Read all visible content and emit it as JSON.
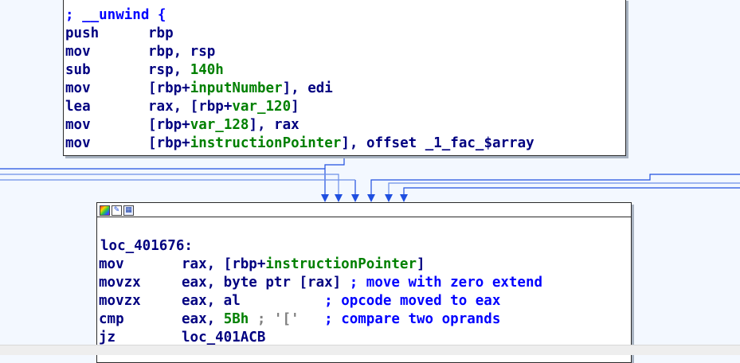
{
  "top_block": {
    "lines": [
      {
        "comment": "; __unwind {"
      },
      {
        "mnemonic": "push",
        "parts": [
          {
            "t": "rbp",
            "c": "reg"
          }
        ]
      },
      {
        "mnemonic": "mov",
        "parts": [
          {
            "t": "rbp, rsp",
            "c": "reg"
          }
        ]
      },
      {
        "mnemonic": "sub",
        "parts": [
          {
            "t": "rsp, ",
            "c": "reg"
          },
          {
            "t": "140h",
            "c": "num"
          }
        ]
      },
      {
        "mnemonic": "mov",
        "parts": [
          {
            "t": "[rbp+",
            "c": "reg"
          },
          {
            "t": "inputNumber",
            "c": "var"
          },
          {
            "t": "], edi",
            "c": "reg"
          }
        ]
      },
      {
        "mnemonic": "lea",
        "parts": [
          {
            "t": "rax, [rbp+",
            "c": "reg"
          },
          {
            "t": "var_120",
            "c": "var"
          },
          {
            "t": "]",
            "c": "reg"
          }
        ]
      },
      {
        "mnemonic": "mov",
        "parts": [
          {
            "t": "[rbp+",
            "c": "reg"
          },
          {
            "t": "var_128",
            "c": "var"
          },
          {
            "t": "], rax",
            "c": "reg"
          }
        ]
      },
      {
        "mnemonic": "mov",
        "parts": [
          {
            "t": "[rbp+",
            "c": "reg"
          },
          {
            "t": "instructionPointer",
            "c": "var"
          },
          {
            "t": "], offset _1_fac_$array",
            "c": "reg"
          }
        ]
      }
    ]
  },
  "loc_block": {
    "label": "loc_401676:",
    "lines": [
      {
        "mnemonic": "mov",
        "parts": [
          {
            "t": "rax, [rbp+",
            "c": "reg"
          },
          {
            "t": "instructionPointer",
            "c": "var"
          },
          {
            "t": "]",
            "c": "reg"
          }
        ]
      },
      {
        "mnemonic": "movzx",
        "parts": [
          {
            "t": "eax, byte ptr [rax] ",
            "c": "reg"
          },
          {
            "t": "; move with zero extend",
            "c": "comment"
          }
        ]
      },
      {
        "mnemonic": "movzx",
        "parts": [
          {
            "t": "eax, al          ",
            "c": "reg"
          },
          {
            "t": "; opcode moved to eax",
            "c": "comment"
          }
        ]
      },
      {
        "mnemonic": "cmp",
        "parts": [
          {
            "t": "eax, ",
            "c": "reg"
          },
          {
            "t": "5Bh",
            "c": "num"
          },
          {
            "t": " ; '['  ",
            "c": "str"
          },
          {
            "t": " ; compare two oprands",
            "c": "comment"
          }
        ]
      },
      {
        "mnemonic": "jz",
        "parts": [
          {
            "t": "loc_401ACB",
            "c": "reg"
          }
        ]
      }
    ]
  },
  "colors": {
    "edge": "#1f4fe0",
    "edge_light": "#6b8fe8",
    "mnemonic": "#000080",
    "variable": "#008000",
    "comment": "#0000ff"
  },
  "icons": [
    "color-icon",
    "rename-icon",
    "graph-icon"
  ]
}
